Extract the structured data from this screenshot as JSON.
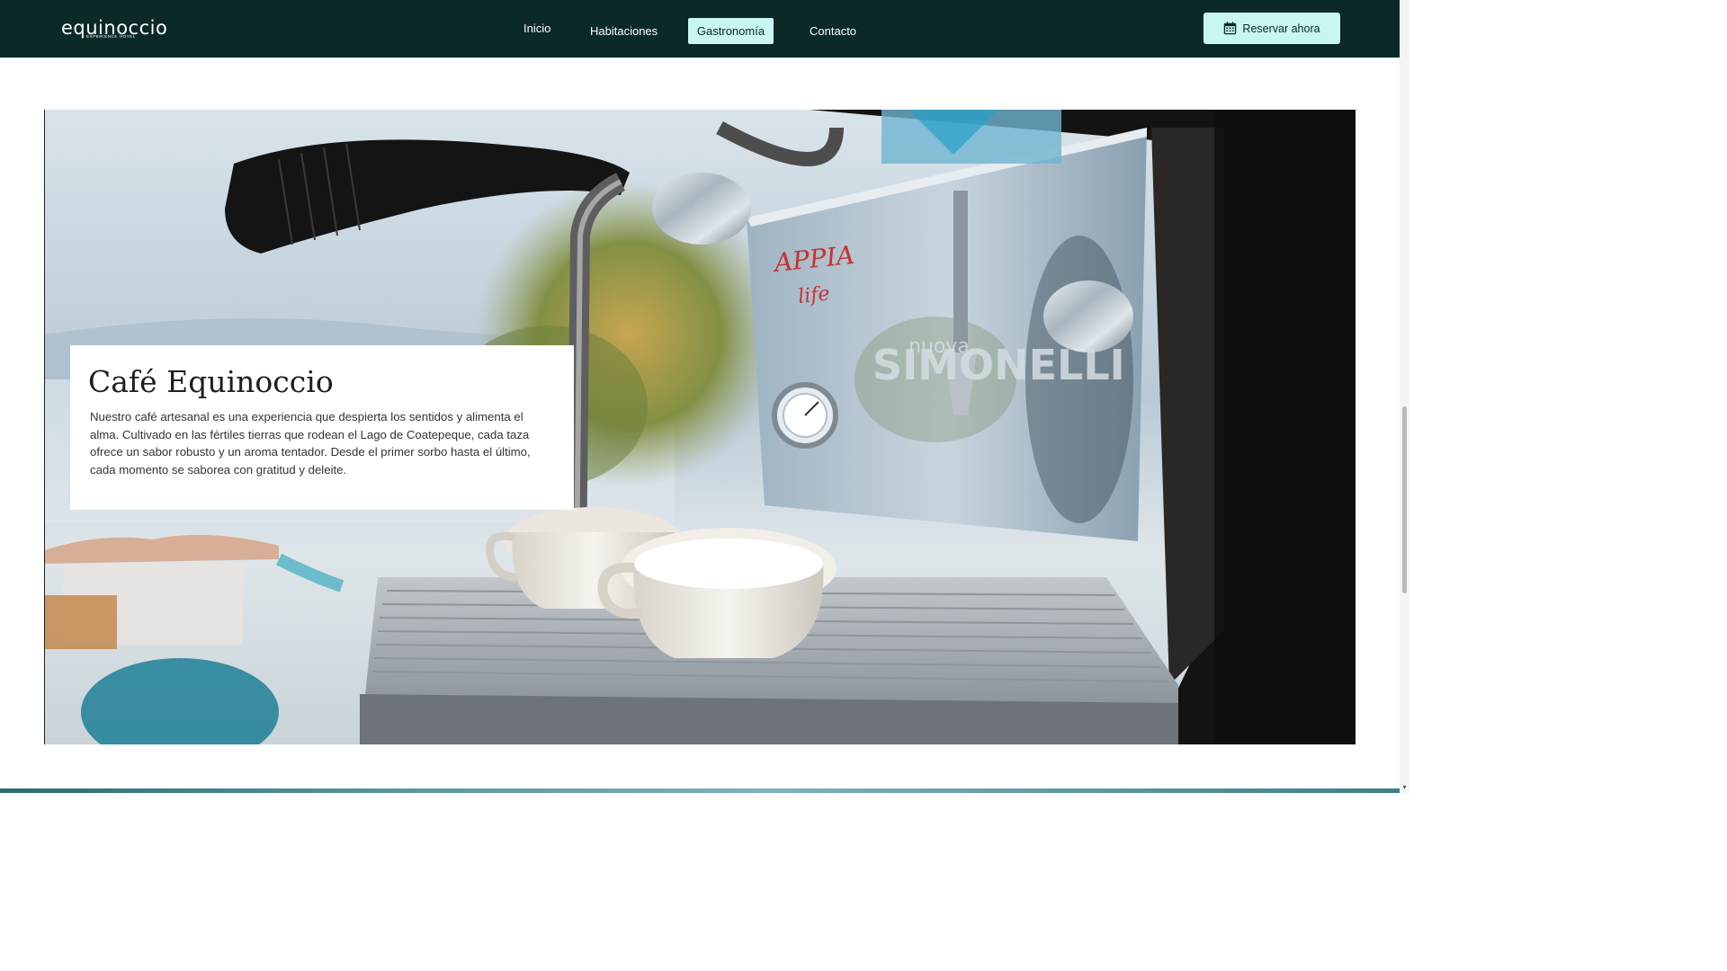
{
  "brand": {
    "name": "equinoccio",
    "tagline": "EXPERIENCE HOTEL"
  },
  "nav": {
    "items": [
      {
        "label": "Inicio"
      },
      {
        "label": "Habitaciones"
      },
      {
        "label": "Gastronomía"
      },
      {
        "label": "Contacto"
      }
    ],
    "active_item": "Gastronomía",
    "reserve_label": "Reservar ahora"
  },
  "hero": {
    "image_subject": "espresso machine with coffee cups",
    "machine_brand_text": "APPIA life",
    "machine_maker_text": "nuova SIMONELLI"
  },
  "card": {
    "title": "Café Equinoccio",
    "body": "Nuestro café artesanal es una experiencia que despierta los sentidos y alimenta el alma. Cultivado en las fértiles tierras que rodean el Lago de Coatepeque, cada taza ofrece un sabor robusto y un aroma tentador. Desde el primer sorbo hasta el último, cada momento se saborea con gratitud y deleite."
  },
  "colors": {
    "nav_background": "#0b2a27",
    "accent": "#c9f5f3",
    "text_dark": "#1e1e1e"
  }
}
